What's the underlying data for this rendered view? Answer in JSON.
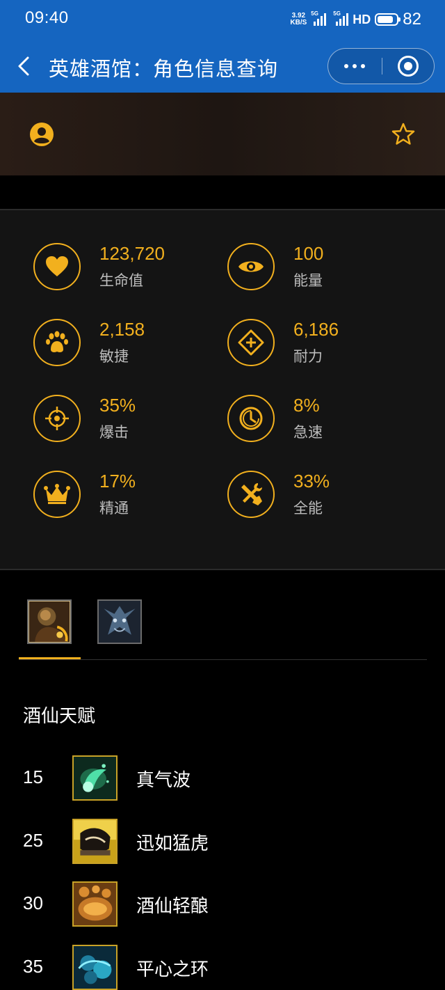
{
  "status_bar": {
    "time": "09:40",
    "net_speed_value": "3.92",
    "net_speed_unit": "KB/S",
    "signal1_label": "5G",
    "signal2_label": "5G",
    "hd_label": "HD",
    "battery": "82"
  },
  "nav": {
    "title": "英雄酒馆：角色信息查询"
  },
  "stats": [
    {
      "value": "123,720",
      "label": "生命值",
      "icon": "heart-icon"
    },
    {
      "value": "100",
      "label": "能量",
      "icon": "eye-icon"
    },
    {
      "value": "2,158",
      "label": "敏捷",
      "icon": "paw-icon"
    },
    {
      "value": "6,186",
      "label": "耐力",
      "icon": "diamond-plus-icon"
    },
    {
      "value": "35%",
      "label": "爆击",
      "icon": "crosshair-icon"
    },
    {
      "value": "8%",
      "label": "急速",
      "icon": "clock-icon"
    },
    {
      "value": "17%",
      "label": "精通",
      "icon": "crown-icon"
    },
    {
      "value": "33%",
      "label": "全能",
      "icon": "tools-icon"
    }
  ],
  "talents": {
    "title": "酒仙天赋",
    "rows": [
      {
        "level": "15",
        "name": "真气波",
        "icon": "chi-wave-icon"
      },
      {
        "level": "25",
        "name": "迅如猛虎",
        "icon": "tiger-boot-icon"
      },
      {
        "level": "30",
        "name": "酒仙轻酿",
        "icon": "brew-icon"
      },
      {
        "level": "35",
        "name": "平心之环",
        "icon": "ring-peace-icon"
      }
    ]
  },
  "colors": {
    "accent": "#f2b01e",
    "nav_blue": "#1565c0"
  }
}
